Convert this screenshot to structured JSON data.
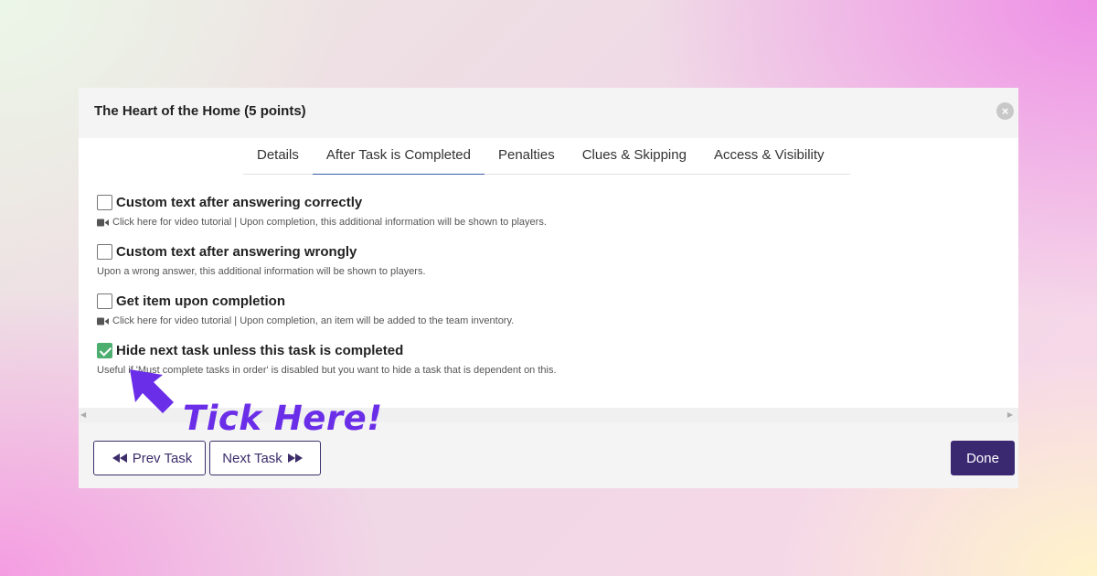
{
  "modal": {
    "title": "The Heart of the Home (5 points)",
    "close_icon": "×"
  },
  "tabs": [
    {
      "label": "Details",
      "active": false
    },
    {
      "label": "After Task is Completed",
      "active": true
    },
    {
      "label": "Penalties",
      "active": false
    },
    {
      "label": "Clues & Skipping",
      "active": false
    },
    {
      "label": "Access & Visibility",
      "active": false
    }
  ],
  "options": [
    {
      "label": "Custom text after answering correctly",
      "checked": false,
      "has_video_icon": true,
      "help": "Click here for video tutorial | Upon completion, this additional information will be shown to players."
    },
    {
      "label": "Custom text after answering wrongly",
      "checked": false,
      "has_video_icon": false,
      "help": "Upon a wrong answer, this additional information will be shown to players."
    },
    {
      "label": "Get item upon completion",
      "checked": false,
      "has_video_icon": true,
      "help": "Click here for video tutorial | Upon completion, an item will be added to the team inventory."
    },
    {
      "label": "Hide next task unless this task is completed",
      "checked": true,
      "has_video_icon": false,
      "help": "Useful if 'Must complete tasks in order' is disabled but you want to hide a task that is dependent on this."
    }
  ],
  "footer": {
    "prev_label": "Prev Task",
    "next_label": "Next Task",
    "done_label": "Done"
  },
  "annotation": {
    "text": "Tick Here!",
    "color": "#6b2ee8"
  },
  "colors": {
    "accent": "#3a2870",
    "checkbox_checked": "#4caf70",
    "active_tab_underline": "#3a5ea8"
  }
}
